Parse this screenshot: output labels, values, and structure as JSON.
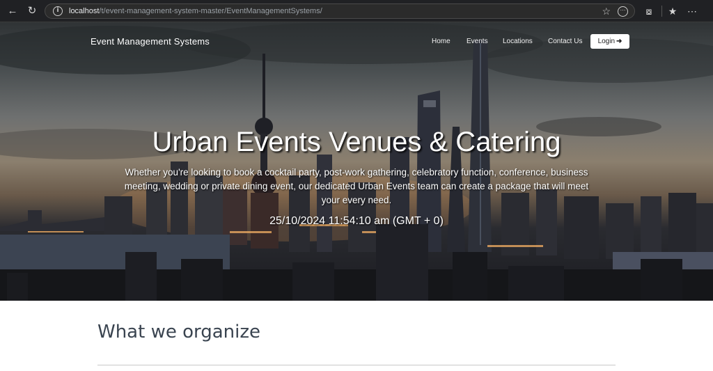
{
  "browser": {
    "url_host": "localhost",
    "url_path": "/t/event-management-system-master/EventManagementSystems/"
  },
  "site": {
    "brand": "Event Management Systems",
    "nav": [
      "Home",
      "Events",
      "Locations",
      "Contact Us"
    ],
    "login_label": "Login"
  },
  "hero": {
    "title": "Urban Events Venues & Catering",
    "description": "Whether you're looking to book a cocktail party, post-work gathering, celebratory function, conference, business meeting, wedding or private dining event, our dedicated Urban Events team can create a package that will meet your every need.",
    "clock": "25/10/2024 11:54:10 am (GMT + 0)"
  },
  "section": {
    "title": "What we organize"
  },
  "colors": {
    "chrome_bg": "#202124",
    "section_title": "#3a4450",
    "login_bg": "#ffffff"
  }
}
